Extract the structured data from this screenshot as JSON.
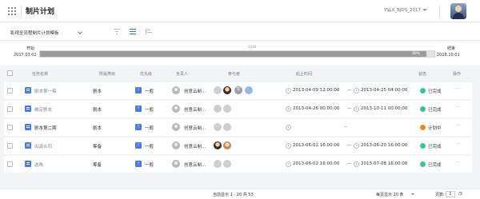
{
  "header": {
    "title": "制片计划",
    "project": "YSLX_BJDS_2017"
  },
  "toolbar": {
    "template_label": "影视全流程制片计划模板",
    "tools": [
      "filter-icon",
      "list-view-icon",
      "gantt-view-icon"
    ],
    "active_tool": "list-view-icon"
  },
  "timeline": {
    "start_label": "开始",
    "start_date": "2017.03.02",
    "end_label": "结束",
    "end_date": "2018.10.01",
    "year": "2018",
    "progress_label": "98%",
    "progress": 0.98
  },
  "table": {
    "headers": {
      "name": "任务名称",
      "category": "所属类目",
      "priority": "优先级",
      "owner": "负责人",
      "participants": "参与者",
      "time": "起止时间",
      "status": "状态",
      "actions": "操作"
    },
    "rows": [
      {
        "name": "剧本第一稿",
        "name_style": "link",
        "category": "剧本",
        "priority": "一般",
        "owner": "创意云制...",
        "start": "2013-04-09 12:00:00",
        "end": "2013-04-25 04:00:00",
        "status": "已完成",
        "status_color": "#3ec48f",
        "actions": "···"
      },
      {
        "name": "确定剧本",
        "name_style": "link",
        "category": "剧本",
        "priority": "一般",
        "owner": "创意云制...",
        "start": "2013-04-26 00:00:00",
        "end": "2013-10-11 00:00:00",
        "status": "已完成",
        "status_color": "#3ec48f",
        "actions": "···"
      },
      {
        "name": "剧本第二期",
        "name_style": "plain",
        "category": "剧本",
        "priority": "一般",
        "owner": "创意云制...",
        "start": "",
        "end": "",
        "dash": "--",
        "status": "计划中",
        "status_color": "#f08a24",
        "actions": "···"
      },
      {
        "name": "出演合同",
        "name_style": "link",
        "category": "筹备",
        "priority": "一般",
        "owner": "创意云制...",
        "start": "2013-06-02 16:00:00",
        "end": "2013-06-20 16:00:00",
        "status": "已完成",
        "status_color": "#3ec48f",
        "actions": "···"
      },
      {
        "name": "选角",
        "name_style": "link",
        "category": "筹备",
        "priority": "一般",
        "owner": "创意云制...",
        "start": "2013-06-02 16:00:00",
        "end": "2013-07-08 16:00:00",
        "status": "已完成",
        "status_color": "#3ec48f",
        "actions": "···"
      }
    ]
  },
  "footer": {
    "count_text": "当前显示 1 - 20 共 53",
    "per_page": "每页显示 20 条",
    "page_label": "页数:",
    "page_value": "1",
    "page_total": "/3"
  }
}
